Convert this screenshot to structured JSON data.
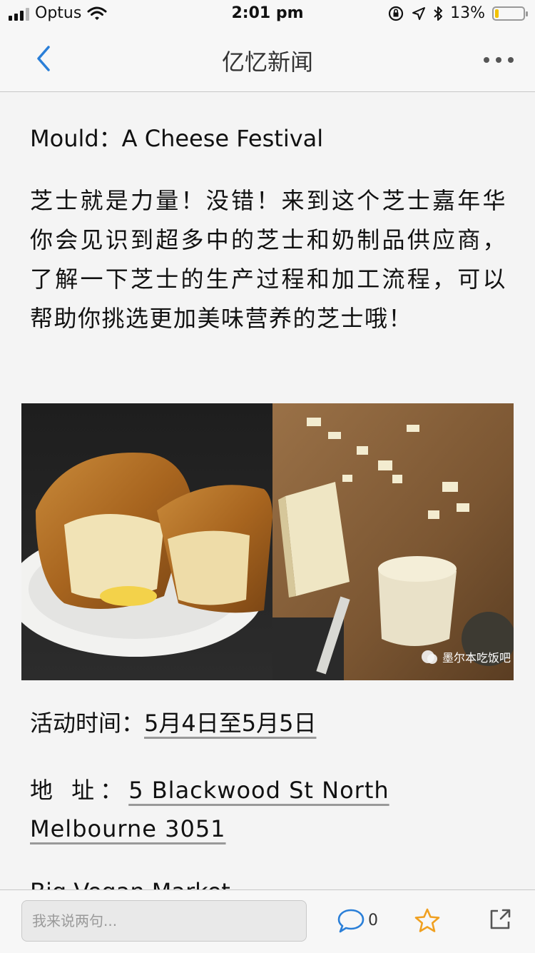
{
  "status_bar": {
    "carrier": "Optus",
    "time": "2:01 pm",
    "battery_text": "13%",
    "battery_level": 0.13,
    "colors": {
      "battery_fill": "#f2c200"
    }
  },
  "nav": {
    "title": "亿忆新闻",
    "back_icon": "chevron-left-icon",
    "more_icon": "more-dots-icon",
    "accent": "#2a7fd8"
  },
  "article": {
    "headline": "Mould：A Cheese Festival",
    "paragraph": "芝士就是力量！没错！来到这个芝士嘉年华你会见识到超多中的芝士和奶制品供应商，了解一下芝士的生产过程和加工流程，可以帮助你挑选更加美味营养的芝士哦！",
    "image_watermark": "墨尔本吃饭吧",
    "event_time_label": "活动时间：",
    "event_time_value": "5月4日至5月5日",
    "address_label": "地 址：",
    "address_value": "5 Blackwood St North Melbourne 3051",
    "next_item_partial": "Big Vegan Market"
  },
  "bottom_bar": {
    "comment_placeholder": "我来说两句...",
    "comment_count": "0",
    "icons": [
      "comment-icon",
      "star-icon",
      "share-icon"
    ],
    "colors": {
      "comment_icon": "#2a7fd8",
      "star_icon": "#f0a020",
      "share_icon": "#555555"
    }
  }
}
